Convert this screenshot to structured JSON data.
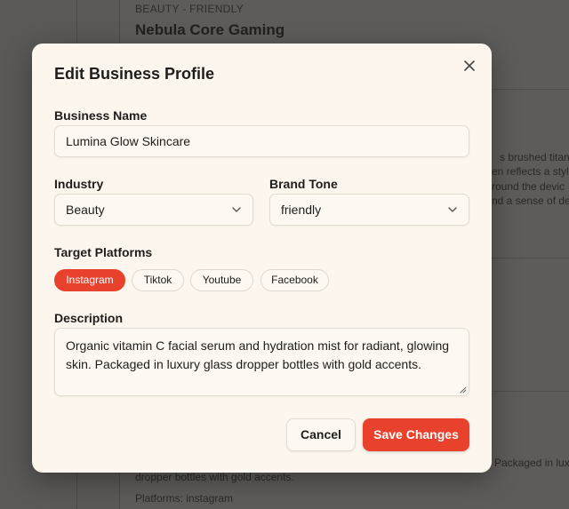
{
  "background": {
    "card_eyebrow": "BEAUTY - FRIENDLY",
    "card_title": "Nebula Core Gaming",
    "desc_fragments": [
      "s brushed titani",
      "en reflects a styli",
      "round the devic",
      "nd a sense of de"
    ],
    "bottom_fragment_right": "Packaged in lux",
    "bottom_line": "dropper bottles with gold accents.",
    "platforms_line": "Platforms: instagram"
  },
  "modal": {
    "title": "Edit Business Profile",
    "close_icon": "close-icon",
    "business_name": {
      "label": "Business Name",
      "value": "Lumina Glow Skincare"
    },
    "industry": {
      "label": "Industry",
      "value": "Beauty"
    },
    "brand_tone": {
      "label": "Brand Tone",
      "value": "friendly"
    },
    "platforms": {
      "label": "Target Platforms",
      "items": [
        {
          "label": "Instagram",
          "selected": true
        },
        {
          "label": "Tiktok",
          "selected": false
        },
        {
          "label": "Youtube",
          "selected": false
        },
        {
          "label": "Facebook",
          "selected": false
        }
      ]
    },
    "description": {
      "label": "Description",
      "value": "Organic vitamin C facial serum and hydration mist for radiant, glowing skin. Packaged in luxury glass dropper bottles with gold accents."
    },
    "cancel_label": "Cancel",
    "save_label": "Save Changes"
  },
  "colors": {
    "accent": "#e8412c",
    "modal_bg": "#fcf6ee",
    "overlay": "#5b5957"
  }
}
